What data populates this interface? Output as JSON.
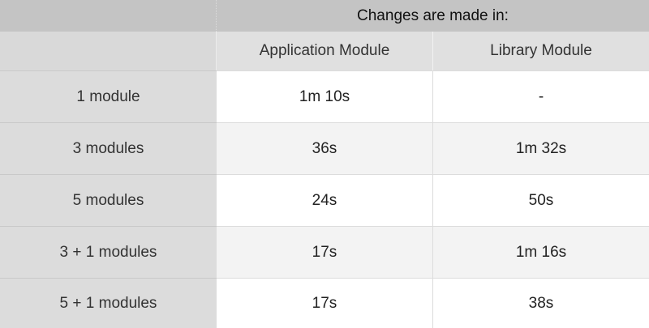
{
  "table": {
    "header": "Changes are made in:",
    "columns": [
      "Application Module",
      "Library Module"
    ],
    "rows": [
      {
        "label": "1 module",
        "application": "1m 10s",
        "library": "-"
      },
      {
        "label": "3 modules",
        "application": "36s",
        "library": "1m 32s"
      },
      {
        "label": "5 modules",
        "application": "24s",
        "library": "50s"
      },
      {
        "label": "3 + 1 modules",
        "application": "17s",
        "library": "1m 16s"
      },
      {
        "label": "5 + 1 modules",
        "application": "17s",
        "library": "38s"
      }
    ]
  }
}
